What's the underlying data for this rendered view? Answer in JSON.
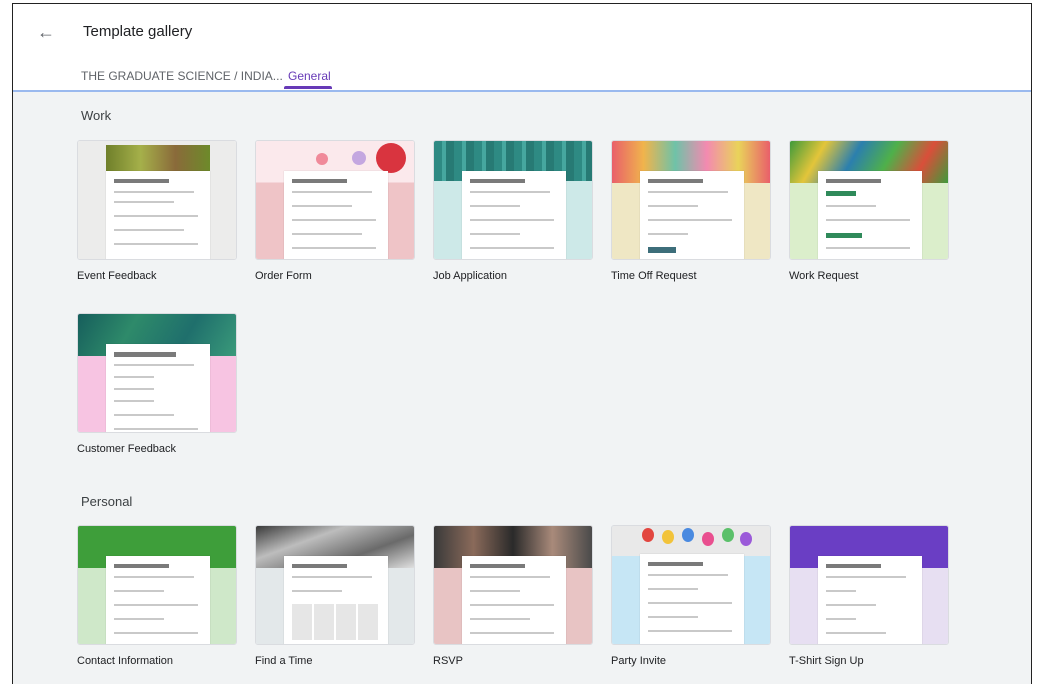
{
  "header": {
    "back_icon": "arrow-back-icon",
    "title": "Template gallery",
    "tabs": [
      {
        "label": "THE GRADUATE SCIENCE / INDIA..."
      },
      {
        "label": "General",
        "selected": true
      }
    ]
  },
  "colors": {
    "accent": "#673ab7",
    "background": "#f1f3f4",
    "divider": "#9ab9ee"
  },
  "sections": [
    {
      "title": "Work",
      "templates": [
        {
          "label": "Event Feedback",
          "header_color": "#7a8b3a",
          "side_color": "#ececeb"
        },
        {
          "label": "Order Form",
          "header_color": "#f2c4cc",
          "side_color": "#efc4c7"
        },
        {
          "label": "Job Application",
          "header_color": "#2e8a83",
          "side_color": "#cde9e8"
        },
        {
          "label": "Time Off Request",
          "header_color": "#e8a25a",
          "side_color": "#efe7c4"
        },
        {
          "label": "Work Request",
          "header_color": "#5aa843",
          "side_color": "#dbeecb"
        },
        {
          "label": "Customer Feedback",
          "header_color": "#1f6f6c",
          "side_color": "#f7c4e2"
        }
      ]
    },
    {
      "title": "Personal",
      "templates": [
        {
          "label": "Contact Information",
          "header_color": "#3e9e3a",
          "side_color": "#cfe8c9"
        },
        {
          "label": "Find a Time",
          "header_color": "#6a6a6a",
          "side_color": "#e3e8ea"
        },
        {
          "label": "RSVP",
          "header_color": "#5a4a4a",
          "side_color": "#e8c4c4"
        },
        {
          "label": "Party Invite",
          "header_color": "#d94f6f",
          "side_color": "#c6e6f5"
        },
        {
          "label": "T-Shirt Sign Up",
          "header_color": "#6a3ec4",
          "side_color": "#e7dff2"
        }
      ]
    }
  ]
}
